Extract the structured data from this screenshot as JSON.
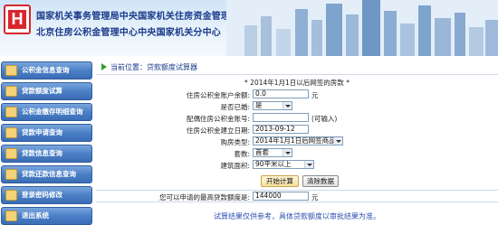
{
  "header": {
    "line1": "国家机关事务管理局中央国家机关住房资金管理中心",
    "line2": "北京住房公积金管理中心中央国家机关分中心",
    "logo_letter": "H",
    "logo_color": "#d9262c"
  },
  "sidebar": {
    "items": [
      {
        "label": "公积金信息查询",
        "icon": "folder-icon"
      },
      {
        "label": "贷款额度试算",
        "icon": "calculator-icon"
      },
      {
        "label": "公积金缴存明细查询",
        "icon": "document-icon"
      },
      {
        "label": "贷款申请查询",
        "icon": "document-icon"
      },
      {
        "label": "贷款信息查询",
        "icon": "folder-icon"
      },
      {
        "label": "贷款还款信息查询",
        "icon": "folder-icon"
      },
      {
        "label": "登录密码修改",
        "icon": "key-icon"
      },
      {
        "label": "退出系统",
        "icon": "exit-icon"
      }
    ]
  },
  "breadcrumb": "当前位置：贷款额度试算器",
  "form": {
    "title": "* 2014年1月1日以后网签的房款 *",
    "fields": [
      {
        "label": "住房公积金账户余额:",
        "value": "0.0",
        "suffix": "元",
        "kind": "input"
      },
      {
        "label": "是否已婚:",
        "value": "是",
        "suffix": "",
        "kind": "select"
      },
      {
        "label": "配偶住房公积金账号:",
        "value": "",
        "suffix": "(可输入)",
        "kind": "input"
      },
      {
        "label": "住房公积金建立日期:",
        "value": "2013-09-12",
        "suffix": "",
        "kind": "input"
      },
      {
        "label": "购房类型:",
        "value": "2014年1月1日后网签商品房",
        "suffix": "",
        "kind": "select"
      },
      {
        "label": "套数:",
        "value": "首套",
        "suffix": "",
        "kind": "select"
      },
      {
        "label": "建筑面积:",
        "value": "90平米以上",
        "suffix": "",
        "kind": "select"
      }
    ],
    "calculate_button": "开始计算",
    "clear_button": "清除数据"
  },
  "result": {
    "label": "您可以申请的最高贷款额度是:",
    "value": "144000",
    "unit": "元"
  },
  "disclaimer": "试算结果仅供参考，具体贷款额度以审批结果为准。",
  "colors": {
    "brand_blue": "#1a3a8a",
    "menu_blue": "#4b7fc6",
    "disclaimer_blue": "#2a4fb0"
  }
}
